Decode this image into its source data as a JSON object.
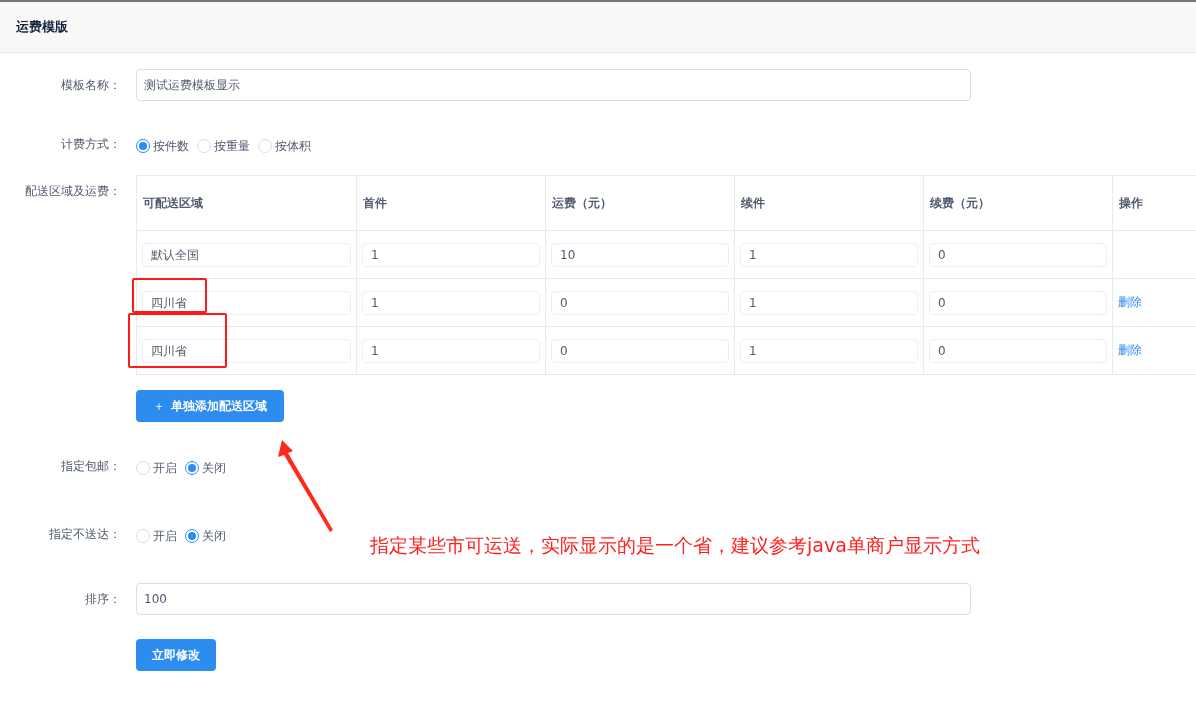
{
  "header": {
    "title": "运费模版"
  },
  "form": {
    "name": {
      "label": "模板名称：",
      "value": "测试运费模板显示"
    },
    "pricing": {
      "label": "计费方式：",
      "options": [
        {
          "label": "按件数",
          "selected": true
        },
        {
          "label": "按重量",
          "selected": false
        },
        {
          "label": "按体积",
          "selected": false
        }
      ]
    },
    "regions": {
      "label": "配送区域及运费：",
      "columns": [
        "可配送区域",
        "首件",
        "运费（元）",
        "续件",
        "续费（元）",
        "操作"
      ],
      "rows": [
        {
          "region": "默认全国",
          "first": "1",
          "fee": "10",
          "extra": "1",
          "extra_fee": "0",
          "highlighted": false
        },
        {
          "region": "四川省",
          "first": "1",
          "fee": "0",
          "extra": "1",
          "extra_fee": "0",
          "action": "删除",
          "highlighted": true
        },
        {
          "region": "四川省",
          "first": "1",
          "fee": "0",
          "extra": "1",
          "extra_fee": "0",
          "action": "删除",
          "highlighted": true
        }
      ],
      "add_button": {
        "icon": "＋",
        "label": "单独添加配送区域"
      }
    },
    "free_shipping": {
      "label": "指定包邮：",
      "options": [
        {
          "label": "开启",
          "selected": false
        },
        {
          "label": "关闭",
          "selected": true
        }
      ]
    },
    "no_delivery": {
      "label": "指定不送达：",
      "options": [
        {
          "label": "开启",
          "selected": false
        },
        {
          "label": "关闭",
          "selected": true
        }
      ]
    },
    "sort": {
      "label": "排序：",
      "value": "100"
    },
    "submit": "立即修改"
  },
  "annotation": {
    "note": "指定某些市可运送，实际显示的是一个省，建议参考java单商户显示方式"
  }
}
